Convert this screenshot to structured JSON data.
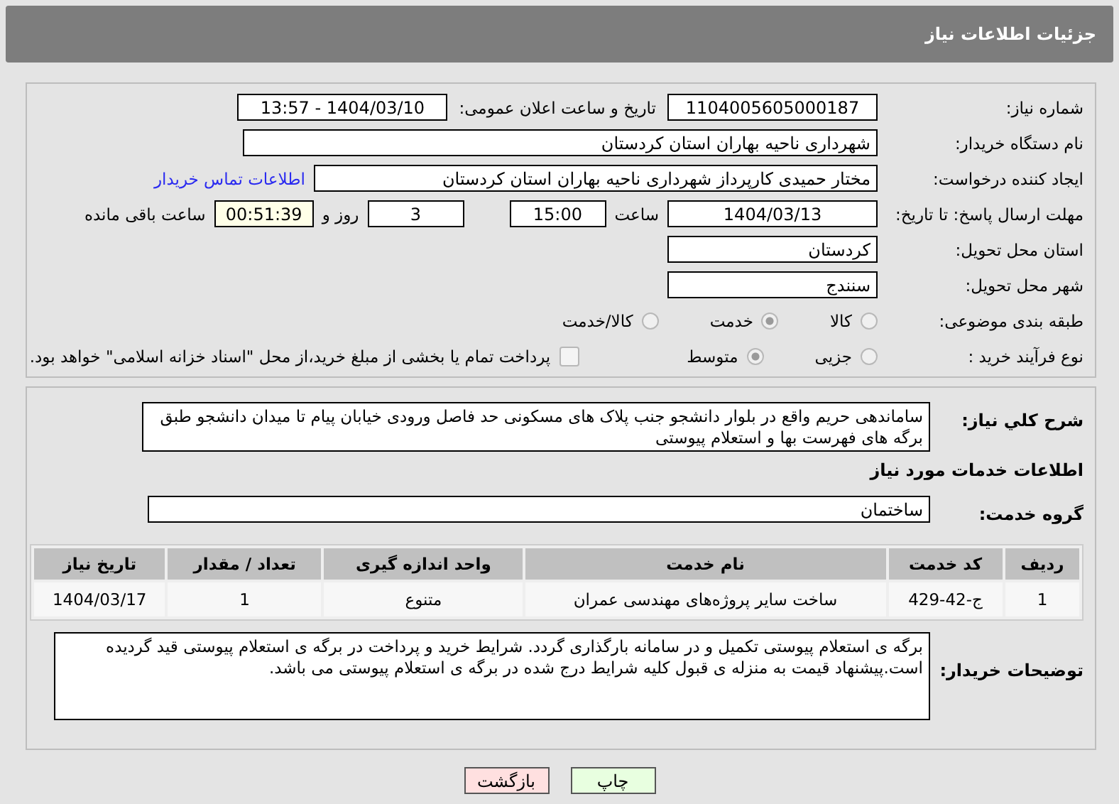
{
  "header": {
    "title": "جزئیات اطلاعات نیاز"
  },
  "need_number": {
    "label": "شماره نیاز:",
    "value": "1104005605000187"
  },
  "announce_datetime": {
    "label": "تاریخ و ساعت اعلان عمومی:",
    "value": "1404/03/10 - 13:57"
  },
  "buyer_org": {
    "label": "نام دستگاه خریدار:",
    "value": "شهرداری ناحیه بهاران استان کردستان"
  },
  "requester": {
    "label": "ایجاد کننده درخواست:",
    "value": "مختار حمیدی کارپرداز شهرداری ناحیه بهاران استان کردستان",
    "link": "اطلاعات تماس خریدار"
  },
  "deadline": {
    "label": "مهلت ارسال پاسخ: تا تاریخ:",
    "date": "1404/03/13",
    "time_label": "ساعت",
    "time": "15:00",
    "days": "3",
    "days_label": "روز و",
    "remaining": "00:51:39",
    "remaining_label": "ساعت باقی مانده"
  },
  "province": {
    "label": "استان محل تحویل:",
    "value": "کردستان"
  },
  "city": {
    "label": "شهر محل تحویل:",
    "value": "سنندج"
  },
  "category": {
    "label": "طبقه بندی موضوعی:",
    "options": [
      {
        "label": "کالا",
        "selected": false
      },
      {
        "label": "خدمت",
        "selected": true
      },
      {
        "label": "کالا/خدمت",
        "selected": false
      }
    ]
  },
  "process": {
    "label": "نوع فرآیند خرید :",
    "options": [
      {
        "label": "جزیی",
        "selected": false
      },
      {
        "label": "متوسط",
        "selected": true
      }
    ],
    "treasury": {
      "checked": false,
      "label": "پرداخت تمام یا بخشی از مبلغ خرید،از محل \"اسناد خزانه اسلامی\" خواهد بود."
    }
  },
  "summary": {
    "label": "شرح کلي نياز:",
    "value": "ساماندهی حریم واقع در بلوار دانشجو جنب پلاک های مسکونی حد فاصل ورودی خیابان پیام تا میدان دانشجو طبق برگه های فهرست بها و استعلام پیوستی"
  },
  "services_heading": "اطلاعات خدمات مورد نیاز",
  "service_group": {
    "label": "گروه خدمت:",
    "value": "ساختمان"
  },
  "table": {
    "columns": [
      "ردیف",
      "کد خدمت",
      "نام خدمت",
      "واحد اندازه گیری",
      "تعداد / مقدار",
      "تاریخ نیاز"
    ],
    "rows": [
      [
        "1",
        "ج-42-429",
        "ساخت سایر پروژه‌های مهندسی عمران",
        "متنوع",
        "1",
        "1404/03/17"
      ]
    ]
  },
  "buyer_notes": {
    "label": "توضیحات خریدار:",
    "value": "برگه ی استعلام پیوستی تکمیل و در سامانه بارگذاری گردد. شرایط خرید و پرداخت در برگه ی استعلام پیوستی قید گردیده است.پیشنهاد قیمت به منزله ی قبول کلیه شرایط درج شده در برگه ی استعلام پیوستی می باشد."
  },
  "buttons": [
    {
      "kind": "print",
      "label": "چاپ"
    },
    {
      "kind": "back",
      "label": "بازگشت"
    }
  ]
}
